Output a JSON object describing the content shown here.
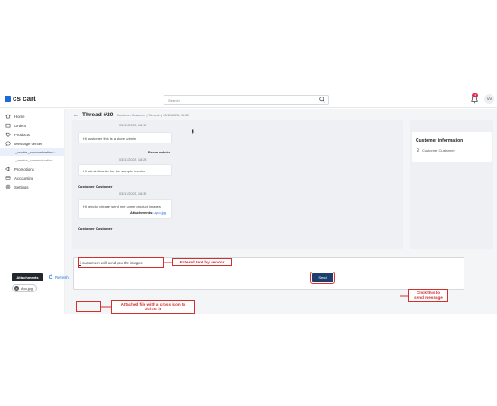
{
  "app": {
    "logo": "cs cart"
  },
  "topbar": {
    "search_placeholder": "Search",
    "notification_count": "13",
    "avatar_initials": "VV"
  },
  "sidebar": {
    "items": [
      {
        "label": "Home",
        "icon": "home-icon"
      },
      {
        "label": "Orders",
        "icon": "orders-icon"
      },
      {
        "label": "Products",
        "icon": "products-icon"
      },
      {
        "label": "Message center",
        "icon": "message-icon"
      }
    ],
    "subitems": [
      {
        "label": "_vendor_communication...",
        "active": true
      },
      {
        "label": "_vendor_communication...",
        "active": false
      }
    ],
    "items2": [
      {
        "label": "Promotions",
        "icon": "promotions-icon"
      },
      {
        "label": "Accounting",
        "icon": "accounting-icon"
      },
      {
        "label": "Settings",
        "icon": "settings-icon"
      }
    ]
  },
  "thread": {
    "title": "Thread #20",
    "meta": "Customer Customer | Simtech | 03/11/2025, 18:32"
  },
  "messages": [
    {
      "timestamp": "03/11/2025, 18:17",
      "text": "Hi customer this is a store admin"
    },
    {
      "sender": "Demo admin",
      "timestamp": "03/11/2025, 18:28",
      "text": "Hi admin thanks for the sample invoice"
    },
    {
      "sender": "Customer Customer",
      "timestamp": "03/11/2025, 18:32",
      "text": "Hi vendor please send me some product images",
      "attachment_label": "Attachments:",
      "attachment_file": "Apo.jpg"
    },
    {
      "sender": "Customer Customer"
    }
  ],
  "info": {
    "title": "Customer information",
    "customer_name": "Customer Customer"
  },
  "compose": {
    "text_prefix": "Hi",
    "text_rest": " customer I will send you the images"
  },
  "actions": {
    "attachments_label": "Attachments",
    "refresh_label": "Refresh",
    "file_name": "Apo.jpg",
    "send_label": "Send"
  },
  "annotations": {
    "entered_text": "Entered text by vendor",
    "attached_file": "Attached file with a cross icon to delete it",
    "send_hint": "Click this to send message"
  },
  "colors": {
    "accent": "#1e6bd6",
    "send": "#1c3f6e",
    "annotation": "#d32f2f",
    "badge": "#e5294f"
  }
}
